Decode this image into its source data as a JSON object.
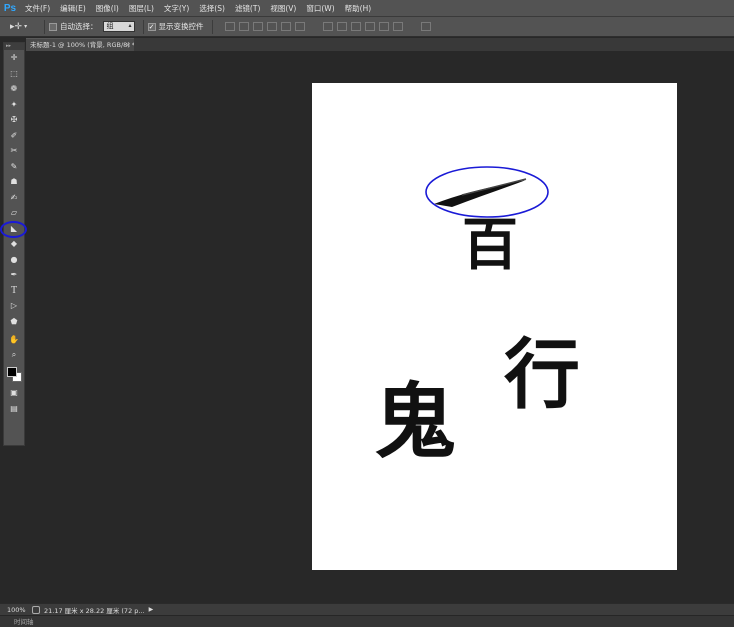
{
  "app": {
    "logo": "Ps"
  },
  "menu": [
    "文件(F)",
    "编辑(E)",
    "图像(I)",
    "图层(L)",
    "文字(Y)",
    "选择(S)",
    "滤镜(T)",
    "视图(V)",
    "窗口(W)",
    "帮助(H)"
  ],
  "options": {
    "auto_select_label": "自动选择：",
    "auto_select_value": "组",
    "show_transform_label": "显示变换控件",
    "show_transform_checked": true
  },
  "document_tab": {
    "title": "未标题-1 @ 100% (背景, RGB/8) *",
    "close": "×"
  },
  "toolbar": {
    "tools": [
      "move-tool",
      "marquee-tool",
      "lasso-tool",
      "quick-select-tool",
      "crop-tool",
      "eyedropper-tool",
      "healing-brush-tool",
      "brush-tool",
      "clone-stamp-tool",
      "history-brush-tool",
      "eraser-tool",
      "paint-bucket-tool",
      "blur-tool",
      "dodge-tool",
      "pen-tool",
      "type-tool",
      "path-select-tool",
      "shape-tool",
      "hand-tool",
      "zoom-tool"
    ],
    "foreground_color": "#000000",
    "background_color": "#ffffff"
  },
  "canvas": {
    "characters": [
      "百",
      "行",
      "鬼"
    ]
  },
  "annotations": {
    "circle_color": "#1a1ad6"
  },
  "status": {
    "zoom": "100%",
    "doc_size": "21.17 厘米 x 28.22 厘米 (72 p..."
  },
  "timeline_label": "时间轴"
}
